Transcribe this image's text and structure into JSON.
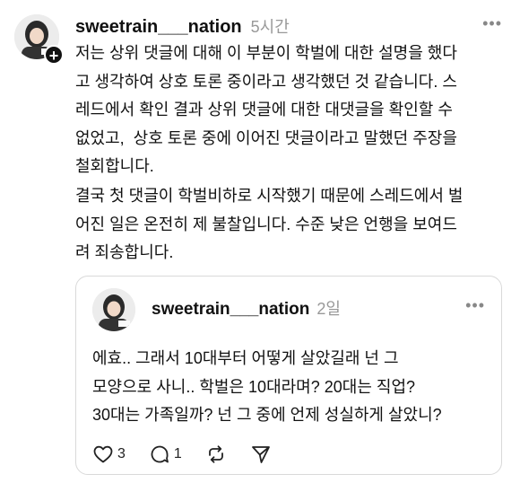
{
  "post": {
    "username": "sweetrain___nation",
    "time": "5시간",
    "more_label": "•••",
    "paragraph1": "저는 상위 댓글에 대해 이 부분이 학벌에 대한 설명을 했다\n고 생각하여 상호 토론 중이라고 생각했던 것 같습니다. 스\n레드에서 확인 결과 상위 댓글에 대한 대댓글을 확인할 수\n없었고,  상호 토론 중에 이어진 댓글이라고 말했던 주장을\n철회합니다.",
    "paragraph2": "결국 첫 댓글이 학벌비하로 시작했기 때문에 스레드에서 벌\n어진 일은 온전히 제 불찰입니다. 수준 낮은 언행을 보여드\n려 죄송합니다.",
    "follow_badge": "+"
  },
  "quoted": {
    "username": "sweetrain___nation",
    "time": "2일",
    "more_label": "•••",
    "text": "에효.. 그래서 10대부터 어떻게 살았길래 넌 그\n모양으로 사니.. 학벌은 10대라며? 20대는 직업?\n30대는 가족일까? 넌 그 중에 언제 성실하게 살았니?",
    "likes": "3",
    "comments": "1"
  },
  "icons": {
    "like": "heart-icon",
    "comment": "comment-icon",
    "repost": "repost-icon",
    "share": "send-icon"
  }
}
